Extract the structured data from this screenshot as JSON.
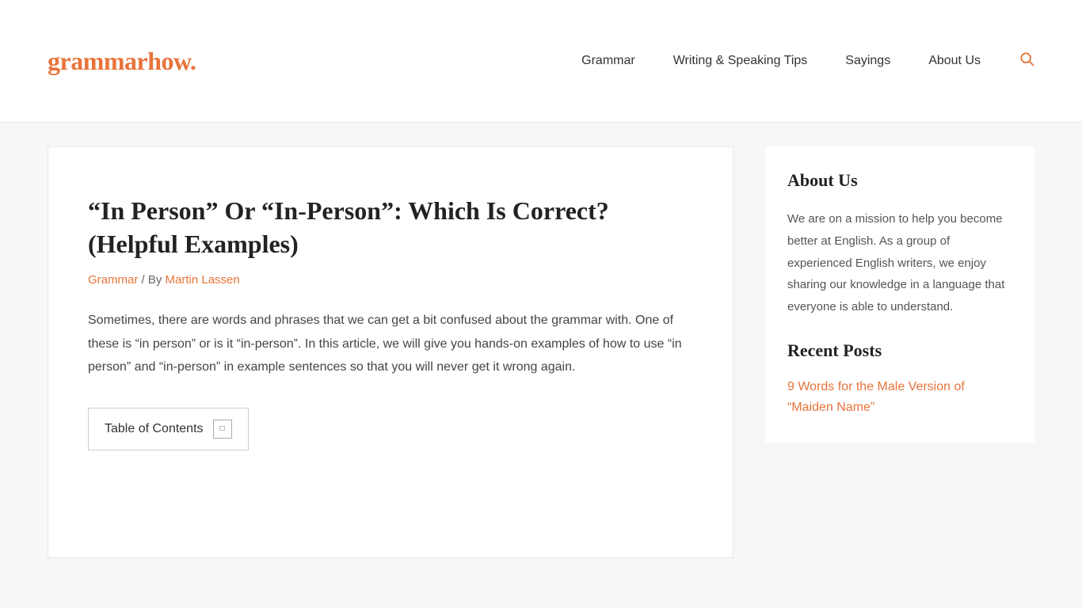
{
  "header": {
    "logo_text": "grammarhow",
    "logo_dot": ".",
    "nav_items": [
      {
        "label": "Grammar",
        "id": "grammar"
      },
      {
        "label": "Writing & Speaking Tips",
        "id": "writing-speaking"
      },
      {
        "label": "Sayings",
        "id": "sayings"
      },
      {
        "label": "About Us",
        "id": "about-us"
      }
    ],
    "search_icon": "🔍"
  },
  "article": {
    "title": "“In Person” Or “In-Person”: Which Is Correct? (Helpful Examples)",
    "meta": {
      "category": "Grammar",
      "separator": "/ By",
      "author": "Martin Lassen"
    },
    "intro": "Sometimes, there are words and phrases that we can get a bit confused about the grammar with. One of these is “in person” or is it “in-person”. In this article, we will give you hands-on examples of how to use “in person” and “in-person” in example sentences so that you will never get it wrong again.",
    "toc": {
      "label": "Table of Contents",
      "toggle_symbol": "□"
    }
  },
  "sidebar": {
    "about": {
      "title": "About Us",
      "text": "We are on a mission to help you become better at English. As a group of experienced English writers, we enjoy sharing our knowledge in a language that everyone is able to understand."
    },
    "recent_posts": {
      "title": "Recent Posts",
      "items": [
        {
          "label": "9 Words for the Male Version of “Maiden Name”"
        }
      ]
    }
  }
}
